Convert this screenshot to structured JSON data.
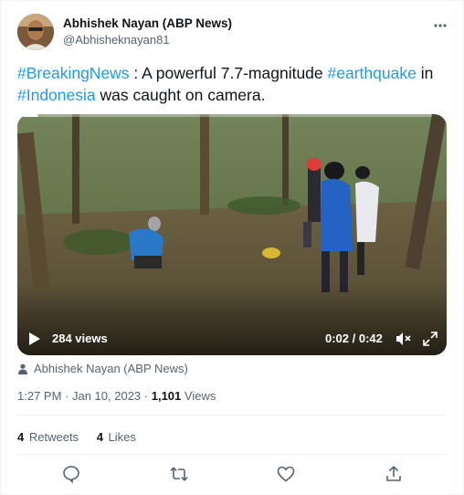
{
  "author": {
    "name": "Abhishek Nayan (ABP News)",
    "handle": "@Abhisheknayan81"
  },
  "more_icon": "more-horizontal-icon",
  "tweet": {
    "tag1": "#BreakingNews",
    "text1": " : A powerful 7.7-magnitude ",
    "tag2": "#earthquake",
    "text2": " in ",
    "tag3": "#Indonesia",
    "text3": " was caught on camera."
  },
  "video": {
    "views": "284 views",
    "time": "0:02 / 0:42",
    "progress": 0.05
  },
  "attribution": "Abhishek Nayan (ABP News)",
  "meta": {
    "time": "1:27 PM",
    "separator1": " · ",
    "date": "Jan 10, 2023",
    "separator2": " · ",
    "view_count": "1,101",
    "views_label": " Views"
  },
  "stats": {
    "retweets_count": "4",
    "retweets_label": "Retweets",
    "likes_count": "4",
    "likes_label": "Likes"
  },
  "colors": {
    "link": "#1d9bf0",
    "secondary": "#536471",
    "primary_text": "#0f1419"
  }
}
